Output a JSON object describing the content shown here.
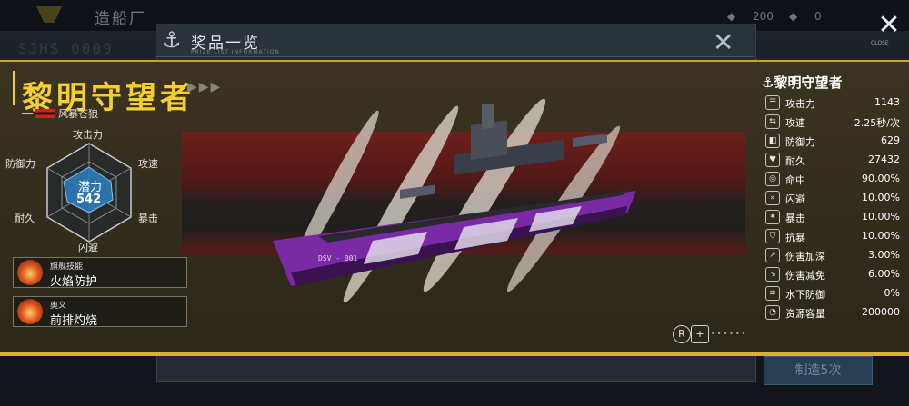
{
  "background": {
    "title": "造船厂",
    "code": "SJHS 0009",
    "resource_1": "200",
    "resource_2": "0",
    "build_button": "制造5次"
  },
  "header": {
    "close_tag": "CLOSE"
  },
  "modal": {
    "title": "奖品一览",
    "subtitle": "PRIZE LIST INFORMATION"
  },
  "ship": {
    "name": "黎明守望者",
    "faction": "风暴苍狼",
    "hull_code": "DSV - 001"
  },
  "radar": {
    "labels": [
      "攻击力",
      "攻速",
      "暴击",
      "闪避",
      "耐久",
      "防御力"
    ],
    "potential_label": "潜力",
    "potential_value": "542"
  },
  "skills": [
    {
      "tag": "旗舰技能",
      "name": "火焰防护"
    },
    {
      "tag": "奥义",
      "name": "前排灼烧"
    }
  ],
  "stats": {
    "title": "黎明守望者",
    "rows": [
      {
        "icon": "attack-power-icon",
        "label": "攻击力",
        "value": "1143"
      },
      {
        "icon": "attack-speed-icon",
        "label": "攻速",
        "value": "2.25秒/次"
      },
      {
        "icon": "defense-icon",
        "label": "防御力",
        "value": "629"
      },
      {
        "icon": "durability-icon",
        "label": "耐久",
        "value": "27432"
      },
      {
        "icon": "accuracy-icon",
        "label": "命中",
        "value": "90.00%"
      },
      {
        "icon": "evasion-icon",
        "label": "闪避",
        "value": "10.00%"
      },
      {
        "icon": "crit-icon",
        "label": "暴击",
        "value": "10.00%"
      },
      {
        "icon": "crit-resist-icon",
        "label": "抗暴",
        "value": "10.00%"
      },
      {
        "icon": "damage-boost-icon",
        "label": "伤害加深",
        "value": "3.00%"
      },
      {
        "icon": "damage-reduce-icon",
        "label": "伤害减免",
        "value": "6.00%"
      },
      {
        "icon": "underwater-defense-icon",
        "label": "水下防御",
        "value": "0%"
      },
      {
        "icon": "resource-capacity-icon",
        "label": "资源容量",
        "value": "200000"
      }
    ]
  },
  "colors": {
    "accent": "#f4cf2f",
    "band": "#2c2719",
    "hull_purple": "#8a2fb8"
  }
}
